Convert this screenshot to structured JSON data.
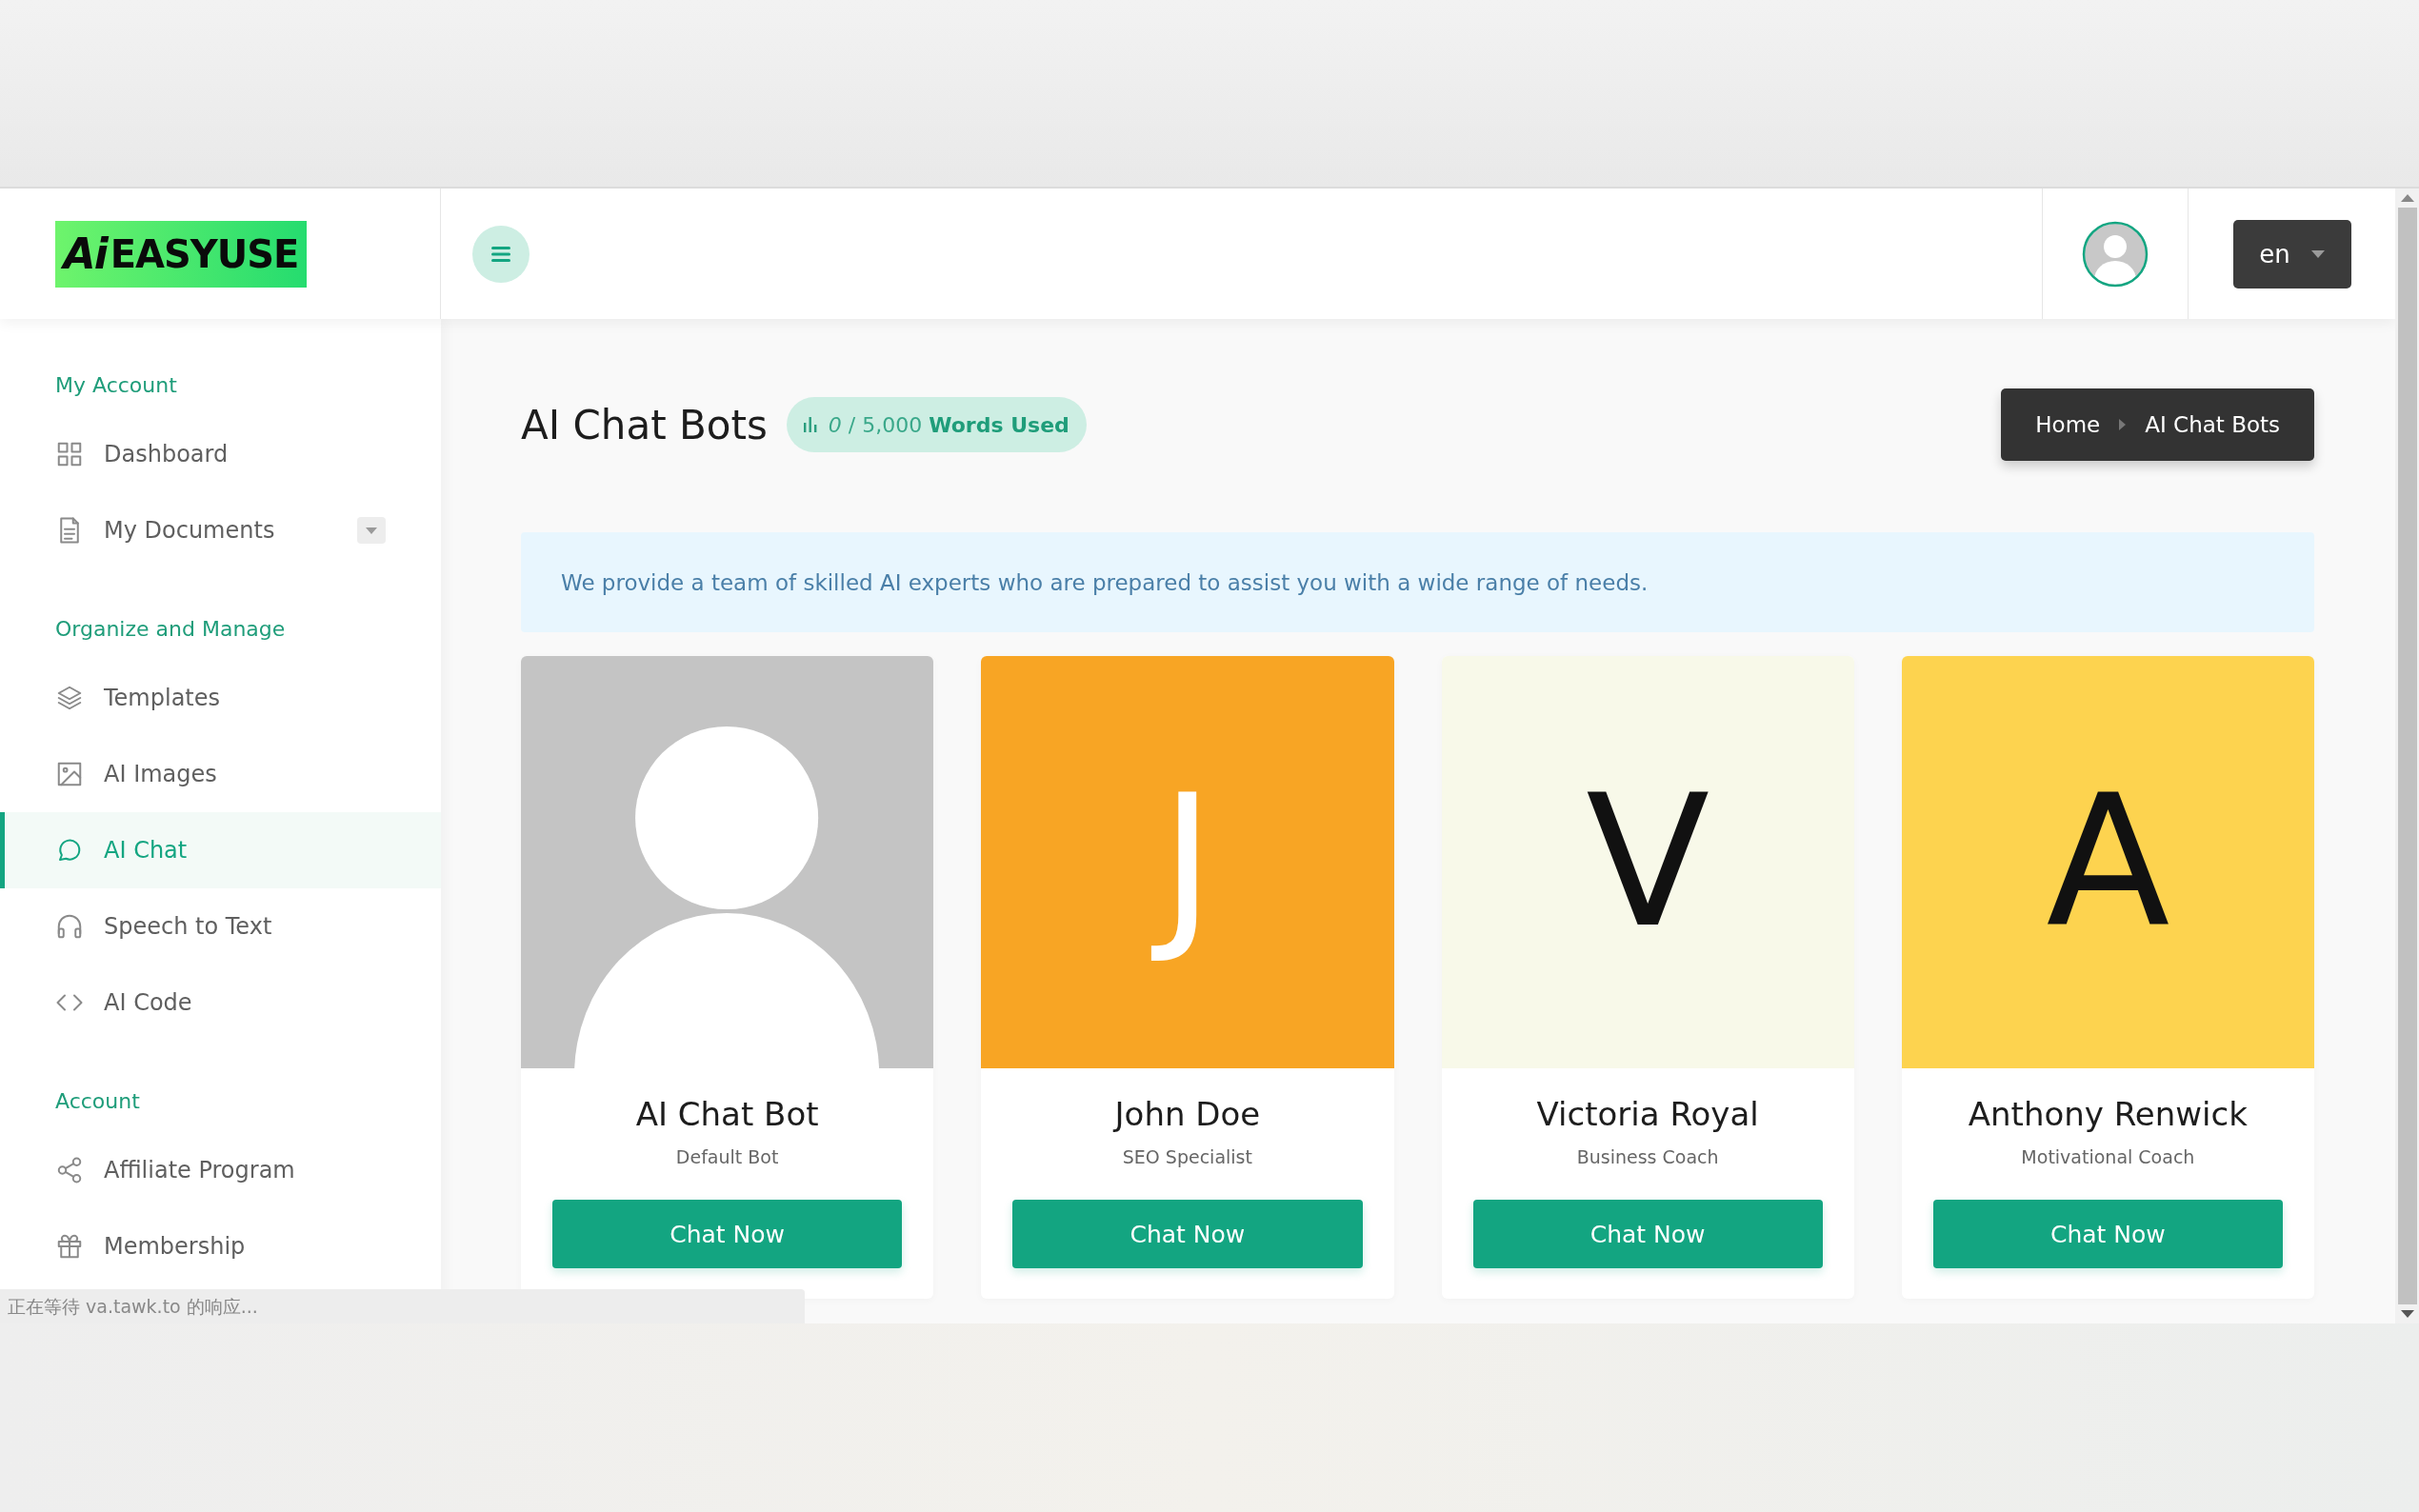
{
  "logo": {
    "mark": "Ai",
    "name": "EASYUSE"
  },
  "language": {
    "value": "en"
  },
  "sidebar": {
    "sections": [
      {
        "title": "My Account",
        "items": [
          {
            "label": "Dashboard",
            "selected": false
          },
          {
            "label": "My Documents",
            "selected": false,
            "expanded": false
          }
        ]
      },
      {
        "title": "Organize and Manage",
        "items": [
          {
            "label": "Templates",
            "selected": false
          },
          {
            "label": "AI Images",
            "selected": false
          },
          {
            "label": "AI Chat",
            "selected": true
          },
          {
            "label": "Speech to Text",
            "selected": false
          },
          {
            "label": "AI Code",
            "selected": false
          }
        ]
      },
      {
        "title": "Account",
        "items": [
          {
            "label": "Affiliate Program",
            "selected": false
          },
          {
            "label": "Membership",
            "selected": false
          }
        ]
      }
    ]
  },
  "page": {
    "title": "AI Chat Bots",
    "usage": "*0* / 5,000 **Words Used**"
  },
  "breadcrumb": [
    "Home",
    "AI Chat Bots"
  ],
  "notice": "We provide a team of skilled AI experts who are prepared to assist you with a wide range of needs.",
  "bots": [
    {
      "kind": "silhouette",
      "color": "#c4c4c4",
      "name": "AI Chat Bot",
      "role": "Default Bot",
      "button": "Chat Now"
    },
    {
      "kind": "letter",
      "letter": "J",
      "color": "#f8a524",
      "name": "John Doe",
      "role": "SEO Specialist",
      "button": "Chat Now"
    },
    {
      "kind": "letter",
      "letter": "V",
      "color": "#f8f9e9",
      "name": "Victoria Royal",
      "role": "Business Coach",
      "button": "Chat Now"
    },
    {
      "kind": "letter",
      "letter": "A",
      "color": "#fdd34f",
      "name": "Anthony Renwick",
      "role": "Motivational Coach",
      "button": "Chat Now"
    }
  ],
  "status_bar": "正在等待 va.tawk.to 的响应..."
}
